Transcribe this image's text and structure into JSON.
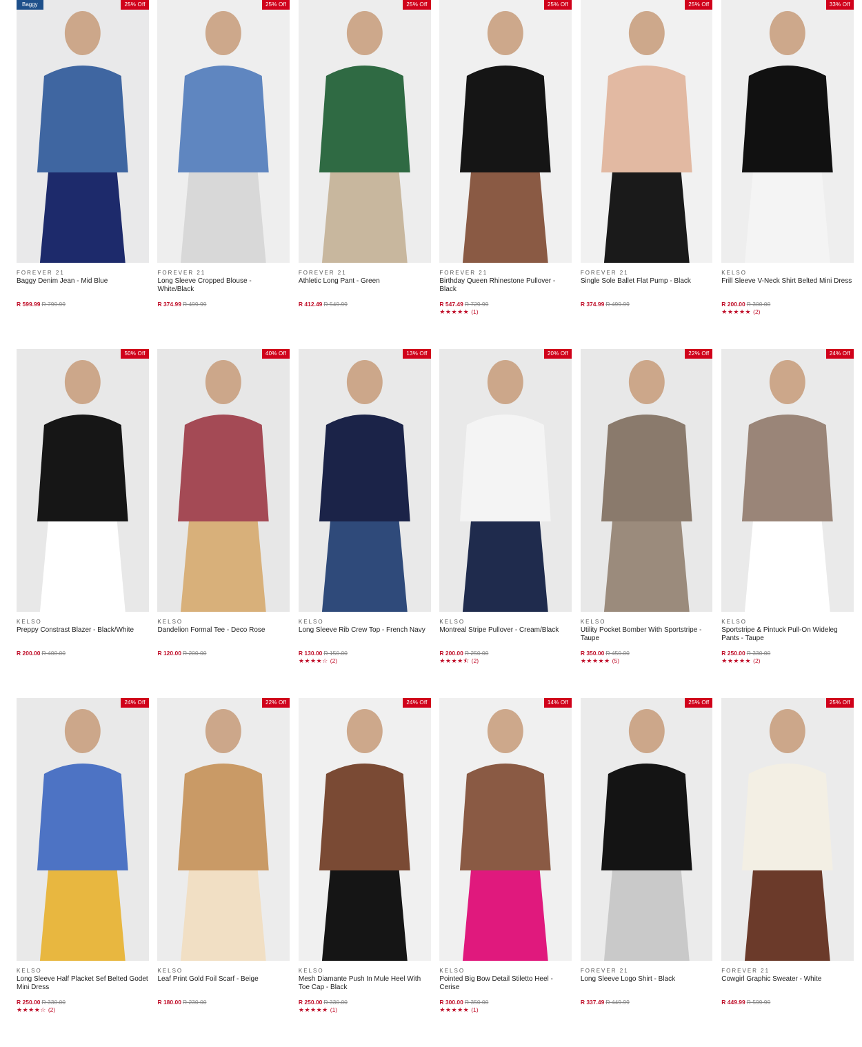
{
  "products": [
    {
      "brand": "FOREVER 21",
      "name": "Baggy Denim Jean - Mid Blue",
      "price": "R 599.99",
      "was": "R 799.99",
      "badge": "25% Off",
      "tag": "Baggy",
      "stars": "",
      "count": "",
      "colors": [
        "#e9e9ea",
        "#3f66a1",
        "#1d2a6b"
      ]
    },
    {
      "brand": "FOREVER 21",
      "name": "Long Sleeve Cropped Blouse - White/Black",
      "price": "R 374.99",
      "was": "R 499.99",
      "badge": "25% Off",
      "tag": "",
      "stars": "",
      "count": "",
      "colors": [
        "#eeeeee",
        "#5f86c0",
        "#d8d8d8"
      ]
    },
    {
      "brand": "FOREVER 21",
      "name": "Athletic Long Pant - Green",
      "price": "R 412.49",
      "was": "R 549.99",
      "badge": "25% Off",
      "tag": "",
      "stars": "",
      "count": "",
      "colors": [
        "#ededed",
        "#2f6a43",
        "#c8b79e"
      ]
    },
    {
      "brand": "FOREVER 21",
      "name": "Birthday Queen Rhinestone Pullover - Black",
      "price": "R 547.49",
      "was": "R 729.99",
      "badge": "25% Off",
      "tag": "",
      "stars": "★★★★★",
      "count": "(1)",
      "colors": [
        "#f0f0f0",
        "#151515",
        "#8a5a44"
      ]
    },
    {
      "brand": "FOREVER 21",
      "name": "Single Sole Ballet Flat Pump - Black",
      "price": "R 374.99",
      "was": "R 499.99",
      "badge": "25% Off",
      "tag": "",
      "stars": "",
      "count": "",
      "colors": [
        "#f1f1f1",
        "#e2b9a2",
        "#1a1a1a"
      ]
    },
    {
      "brand": "KELSO",
      "name": "Frill Sleeve V-Neck Shirt Belted Mini Dress",
      "price": "R 200.00",
      "was": "R 300.00",
      "badge": "33% Off",
      "tag": "",
      "stars": "★★★★★",
      "count": "(2)",
      "colors": [
        "#eeeeee",
        "#111111",
        "#f4f4f4"
      ]
    },
    {
      "brand": "KELSO",
      "name": "Preppy Constrast Blazer - Black/White",
      "price": "R 200.00",
      "was": "R 400.00",
      "badge": "50% Off",
      "tag": "",
      "stars": "",
      "count": "",
      "colors": [
        "#e8e8e8",
        "#161616",
        "#ffffff"
      ]
    },
    {
      "brand": "KELSO",
      "name": "Dandelion Formal Tee - Deco Rose",
      "price": "R 120.00",
      "was": "R 200.00",
      "badge": "40% Off",
      "tag": "",
      "stars": "",
      "count": "",
      "colors": [
        "#e7e7e7",
        "#a44a55",
        "#d8b07a"
      ]
    },
    {
      "brand": "KELSO",
      "name": "Long Sleeve Rib Crew Top - French Navy",
      "price": "R 130.00",
      "was": "R 150.00",
      "badge": "13% Off",
      "tag": "",
      "stars": "★★★★☆",
      "count": "(2)",
      "colors": [
        "#e9e9e9",
        "#1b2348",
        "#2f4a7a"
      ]
    },
    {
      "brand": "KELSO",
      "name": "Montreal Stripe Pullover - Cream/Black",
      "price": "R 200.00",
      "was": "R 250.00",
      "badge": "20% Off",
      "tag": "",
      "stars": "★★★★⯪",
      "count": "(2)",
      "colors": [
        "#e9e9e9",
        "#f4f4f4",
        "#1f2b4d"
      ]
    },
    {
      "brand": "KELSO",
      "name": "Utility Pocket Bomber With Sportstripe - Taupe",
      "price": "R 350.00",
      "was": "R 450.00",
      "badge": "22% Off",
      "tag": "",
      "stars": "★★★★★",
      "count": "(5)",
      "colors": [
        "#e8e8e8",
        "#8a7a6c",
        "#9b8b7c"
      ]
    },
    {
      "brand": "KELSO",
      "name": "Sportstripe & Pintuck Pull-On Wideleg Pants - Taupe",
      "price": "R 250.00",
      "was": "R 330.00",
      "badge": "24% Off",
      "tag": "",
      "stars": "★★★★★",
      "count": "(2)",
      "colors": [
        "#eaeaea",
        "#9a8578",
        "#ffffff"
      ]
    },
    {
      "brand": "KELSO",
      "name": "Long Sleeve Half Placket Sef Belted Godet Mini Dress",
      "price": "R 250.00",
      "was": "R 330.00",
      "badge": "24% Off",
      "tag": "",
      "stars": "★★★★☆",
      "count": "(2)",
      "colors": [
        "#e9e9e9",
        "#4d73c4",
        "#e8b740"
      ]
    },
    {
      "brand": "KELSO",
      "name": "Leaf Print Gold Foil Scarf - Beige",
      "price": "R 180.00",
      "was": "R 230.00",
      "badge": "22% Off",
      "tag": "",
      "stars": "",
      "count": "",
      "colors": [
        "#ececec",
        "#c99a66",
        "#f1dfc4"
      ]
    },
    {
      "brand": "KELSO",
      "name": "Mesh Diamante Push In Mule Heel With Toe Cap - Black",
      "price": "R 250.00",
      "was": "R 330.00",
      "badge": "24% Off",
      "tag": "",
      "stars": "★★★★★",
      "count": "(1)",
      "colors": [
        "#f0f0f0",
        "#7a4a34",
        "#151515"
      ]
    },
    {
      "brand": "KELSO",
      "name": "Pointed Big Bow Detail Stiletto Heel - Cerise",
      "price": "R 300.00",
      "was": "R 350.00",
      "badge": "14% Off",
      "tag": "",
      "stars": "★★★★★",
      "count": "(1)",
      "colors": [
        "#f0f0f0",
        "#8a5a44",
        "#e0197d"
      ]
    },
    {
      "brand": "FOREVER 21",
      "name": "Long Sleeve Logo Shirt - Black",
      "price": "R 337.49",
      "was": "R 449.99",
      "badge": "25% Off",
      "tag": "",
      "stars": "",
      "count": "",
      "colors": [
        "#ebebeb",
        "#141414",
        "#c9c9c9"
      ]
    },
    {
      "brand": "FOREVER 21",
      "name": "Cowgirl Graphic Sweater - White",
      "price": "R 449.99",
      "was": "R 599.99",
      "badge": "25% Off",
      "tag": "",
      "stars": "",
      "count": "",
      "colors": [
        "#ebebeb",
        "#f3efe4",
        "#6b3a2a"
      ]
    }
  ]
}
